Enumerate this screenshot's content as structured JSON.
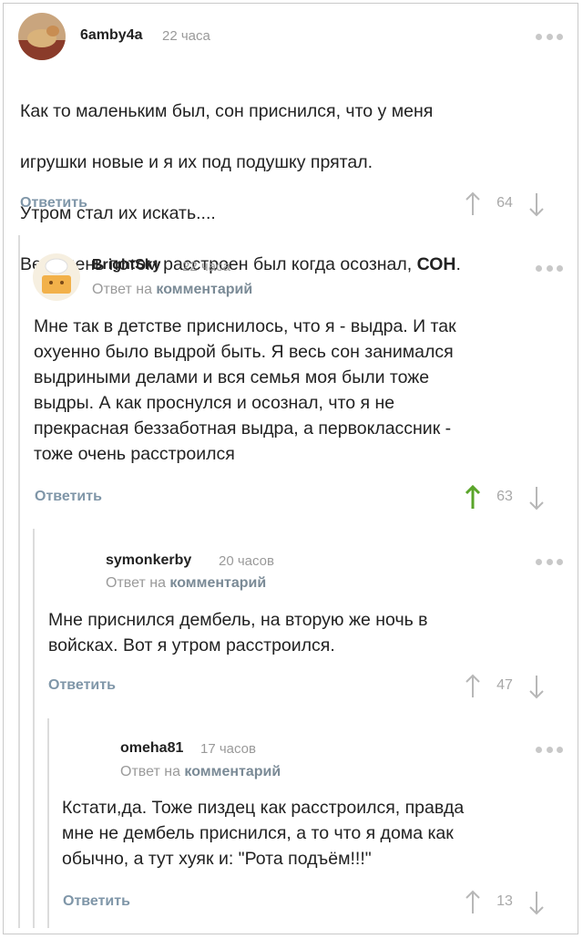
{
  "comments": [
    {
      "username": "6amby4a",
      "time": "22 часа",
      "reply_prefix": "",
      "reply_target": "",
      "text_lines": [
        "Как то маленьким был, сон приснился, что у меня",
        "игрушки новые и я их под подушку прятал.",
        "Утром стал их искать....",
        "Весь день потом расстроен был когда осознал, "
      ],
      "text_bold": "СОН",
      "text_tail": ".",
      "reply_label": "Ответить",
      "votes": "64",
      "upvoted": false
    },
    {
      "username": "BrightSky",
      "time": "22 часа",
      "reply_prefix": "Ответ на ",
      "reply_target": "комментарий",
      "text": "Мне так в детстве приснилось, что я - выдра. И так\nохуенно было выдрой быть. Я весь сон занимался\nвыдриными делами и вся семья моя были тоже\nвыдры. А как проснулся и осознал, что я не\nпрекрасная беззаботная выдра, а первоклассник -\nтоже очень расстроился",
      "reply_label": "Ответить",
      "votes": "63",
      "upvoted": true
    },
    {
      "username": "symonkerby",
      "time": "20 часов",
      "reply_prefix": "Ответ на ",
      "reply_target": "комментарий",
      "text": "Мне приснился дембель, на вторую же ночь в\nвойсках. Вот я утром расстроился.",
      "reply_label": "Ответить",
      "votes": "47",
      "upvoted": false
    },
    {
      "username": "omeha81",
      "time": "17 часов",
      "reply_prefix": "Ответ на ",
      "reply_target": "комментарий",
      "text": "Кстати,да. Тоже пиздец как расстроился, правда\nмне не дембель приснился, а то что я дома как\nобычно, а тут хуяк и: \"Рота подъём!!!\"",
      "reply_label": "Ответить",
      "votes": "13",
      "upvoted": false
    }
  ],
  "colors": {
    "upvote_active": "#5aa52a",
    "arrow_default": "#b7b7b7",
    "link": "#7f96a8",
    "muted": "#9a9a9a"
  }
}
